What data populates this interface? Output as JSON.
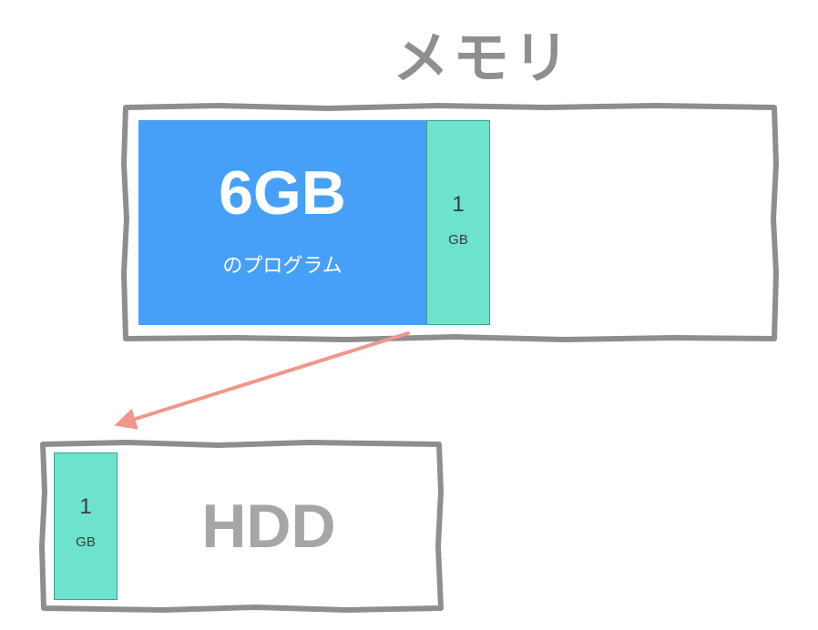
{
  "diagram": {
    "memory": {
      "title": "メモリ",
      "program": {
        "size_label": "6GB",
        "caption": "のプログラム",
        "color": "#47a0f8"
      },
      "swapped_chunk": {
        "number": "1",
        "unit": "GB",
        "color": "#6de2cc"
      }
    },
    "hdd": {
      "label": "HDD",
      "chunk": {
        "number": "1",
        "unit": "GB",
        "color": "#6de2cc"
      }
    },
    "arrow": {
      "color": "#f0978b",
      "direction": "memory-to-hdd"
    },
    "frame_color": "#8e8e8e"
  }
}
